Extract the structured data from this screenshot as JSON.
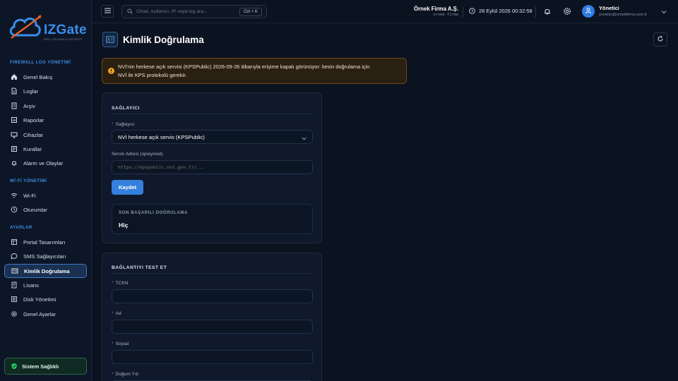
{
  "brand": {
    "name": "IZGate",
    "tagline": "5651 LOGLAMA & HOTSPOT"
  },
  "sidebar": {
    "sections": [
      {
        "title": "FIREWALL LOG YÖNETİMİ",
        "items": [
          {
            "label": "Genel Bakış",
            "icon": "home-icon"
          },
          {
            "label": "Loglar",
            "icon": "file-icon"
          },
          {
            "label": "Arşiv",
            "icon": "archive-icon"
          },
          {
            "label": "Raporlar",
            "icon": "report-icon"
          },
          {
            "label": "Cihazlar",
            "icon": "monitor-icon"
          },
          {
            "label": "Kurallar",
            "icon": "rules-icon"
          },
          {
            "label": "Alarm ve Olaylar",
            "icon": "bell-icon"
          }
        ]
      },
      {
        "title": "Wİ-Fİ YÖNETİMİ",
        "items": [
          {
            "label": "Wi-Fi",
            "icon": "wifi-icon"
          },
          {
            "label": "Oturumlar",
            "icon": "clock-icon"
          }
        ]
      },
      {
        "title": "AYARLAR",
        "items": [
          {
            "label": "Portal Tasarımları",
            "icon": "layout-icon"
          },
          {
            "label": "SMS Sağlayıcıları",
            "icon": "message-icon"
          },
          {
            "label": "Kimlik Doğrulama",
            "icon": "id-card-icon",
            "active": true
          },
          {
            "label": "Lisans",
            "icon": "license-icon"
          },
          {
            "label": "Disk Yönetimi",
            "icon": "disk-icon"
          },
          {
            "label": "Genel Ayarlar",
            "icon": "gear-icon"
          }
        ]
      }
    ],
    "health_label": "Sistem Sağlıklı"
  },
  "topbar": {
    "search_placeholder": "Cihaz, kullanıcı, IP veya log ara...",
    "shortcut": "Ctrl + K",
    "company_name": "Örnek Firma A.Ş.",
    "company_slug": "ornek-firma",
    "datetime": "28 Eylül 2026 00:32:58",
    "user_name": "Yönetici",
    "user_email": "yonetici@ornekfirma.com.tr"
  },
  "page": {
    "title": "Kimlik Doğrulama",
    "warning_line1": "NVİ'nin herkese açık servisi (KPSPublic) 2026-09-26 itibarıyla erişime kapalı görünüyor: kesin doğrulama için",
    "warning_line2": "NVİ ile KPS protokolü gerekir."
  },
  "provider_card": {
    "title": "SAĞLAYICI",
    "provider_label": "Sağlayıcı",
    "provider_value": "NVİ herkese açık servis (KPSPublic)",
    "service_url_label": "Servis Adresi (opsiyonel)",
    "service_url_placeholder": "https://kpspublic.nvi.gov.tr/...",
    "save_label": "Kaydet",
    "last_success_title": "SON BAŞARILI DOĞRULAMA",
    "last_success_value": "Hiç"
  },
  "test_card": {
    "title": "BAĞLANTIYI TEST ET",
    "tckn_label": "TCKN",
    "ad_label": "Ad",
    "soyad_label": "Soyad",
    "dogum_label": "Doğum Yılı"
  },
  "colors": {
    "accent": "#3580dc",
    "background": "#0b1220",
    "card": "#0f192b",
    "warning_bg": "#2a2012",
    "warning_icon": "#f0a020",
    "success": "#22c55e",
    "required": "#e0484b"
  }
}
